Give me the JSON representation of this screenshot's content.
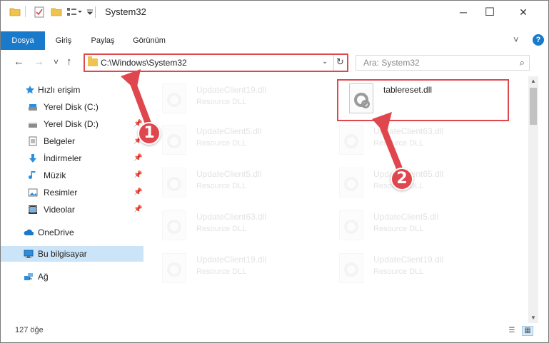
{
  "window": {
    "title": "System32",
    "controls": {
      "minimize": "─",
      "maximize": "☐",
      "close": "✕"
    }
  },
  "quick_access_toolbar": [
    "folder-icon",
    "properties-icon",
    "new-folder-icon",
    "customize-icon"
  ],
  "ribbon": {
    "tabs": [
      {
        "label": "Dosya",
        "active": true
      },
      {
        "label": "Giriş"
      },
      {
        "label": "Paylaş"
      },
      {
        "label": "Görünüm"
      }
    ],
    "expand_icon": "˅",
    "help_label": "?"
  },
  "navigation": {
    "back": "←",
    "forward": "→",
    "recent": "˅",
    "up": "↑",
    "address": "C:\\Windows\\System32",
    "dropdown": "⌄",
    "refresh": "↻",
    "search_placeholder": "Ara: System32",
    "search_icon": "⌕"
  },
  "sidebar": {
    "items": [
      {
        "label": "Hızlı erişim",
        "icon": "star-icon"
      },
      {
        "label": "Yerel Disk (C:)",
        "icon": "drive-icon"
      },
      {
        "label": "Yerel Disk (D:)",
        "icon": "drive-icon",
        "pinned": true
      },
      {
        "label": "Belgeler",
        "icon": "documents-icon",
        "pinned": true
      },
      {
        "label": "İndirmeler",
        "icon": "download-icon",
        "pinned": true
      },
      {
        "label": "Müzik",
        "icon": "music-icon",
        "pinned": true
      },
      {
        "label": "Resimler",
        "icon": "pictures-icon",
        "pinned": true
      },
      {
        "label": "Videolar",
        "icon": "video-icon",
        "pinned": true
      },
      {
        "label": "OneDrive",
        "icon": "cloud-icon"
      },
      {
        "label": "Bu bilgisayar",
        "icon": "computer-icon",
        "selected": true
      },
      {
        "label": "Ağ",
        "icon": "network-icon"
      }
    ],
    "pin_glyph": "📌"
  },
  "files": [
    {
      "name": "UpdateClient19.dll",
      "type": "Resource DLL",
      "faded": true
    },
    {
      "name": "tablereset.dll",
      "type": "",
      "faded": false
    },
    {
      "name": "UpdateClient5.dll",
      "type": "Resource DLL",
      "faded": true
    },
    {
      "name": "UpdateClient63.dll",
      "type": "Resource DLL",
      "faded": true
    },
    {
      "name": "UpdateClient5.dll",
      "type": "Resource DLL",
      "faded": true
    },
    {
      "name": "UpdateClient65.dll",
      "type": "Resource DLL",
      "faded": true
    },
    {
      "name": "UpdateClient63.dll",
      "type": "Resource DLL",
      "faded": true
    },
    {
      "name": "UpdateClient5.dll",
      "type": "Resource DLL",
      "faded": true
    },
    {
      "name": "UpdateClient19.dll",
      "type": "Resource DLL",
      "faded": true
    },
    {
      "name": "UpdateClient19.dll",
      "type": "Resource DLL",
      "faded": true
    }
  ],
  "annotations": {
    "step1": "1",
    "step2": "2",
    "color": "#e0464d"
  },
  "status": {
    "item_count": "127 öğe"
  },
  "scrollbar": {
    "up": "▲",
    "down": "▼"
  },
  "view_buttons": {
    "details": "☰",
    "tiles": "▦"
  }
}
